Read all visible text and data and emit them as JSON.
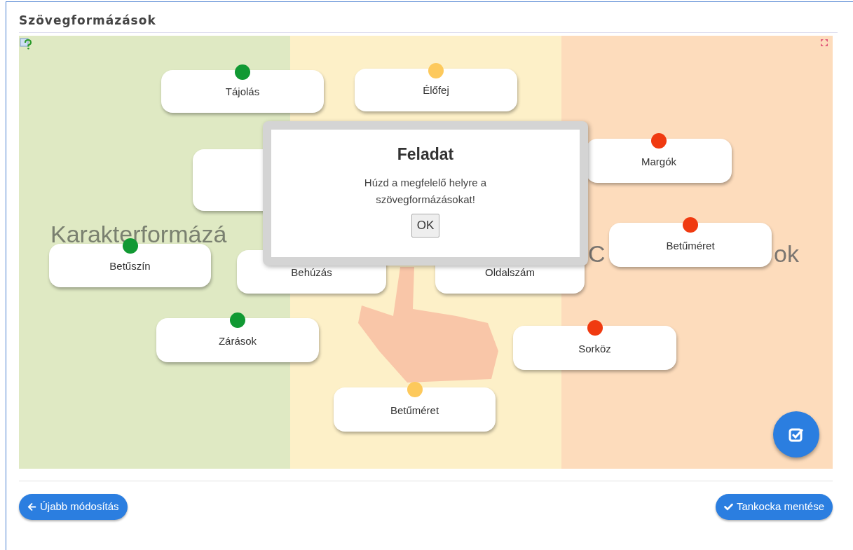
{
  "title": "Szövegformázások",
  "zones": [
    {
      "kind": "labeled",
      "label": "Karakterformázá"
    },
    {
      "kind": "unlabeled"
    },
    {
      "kind": "split",
      "label_parts": [
        "C",
        "ok"
      ]
    }
  ],
  "cards": [
    {
      "kind": "tile",
      "label": "Tájolás",
      "color": "#119933"
    },
    {
      "kind": "tile",
      "label": "Élőfej",
      "color": "#fdc95c"
    },
    {
      "kind": "blank"
    },
    {
      "kind": "tile",
      "label": "Margók",
      "color": "#f03a10"
    },
    {
      "kind": "tile",
      "label": "Betűszín",
      "color": "#119933"
    },
    {
      "kind": "tile",
      "label": "Behúzás"
    },
    {
      "kind": "tile",
      "label": "Oldalszám"
    },
    {
      "kind": "tile",
      "label": "Betűméret",
      "color": "#f03a10"
    },
    {
      "kind": "tile",
      "label": "Zárások",
      "color": "#119933"
    },
    {
      "kind": "tile",
      "label": "Sorköz",
      "color": "#f03a10"
    },
    {
      "kind": "tile",
      "label": "Betűméret",
      "color": "#fdc95c"
    }
  ],
  "dialog": {
    "title": "Feladat",
    "message": "Húzd a megfelelő helyre a szövegformázásokat!",
    "button": "OK"
  },
  "buttons": {
    "back": "Újabb módosítás",
    "save": "Tankocka mentése"
  }
}
